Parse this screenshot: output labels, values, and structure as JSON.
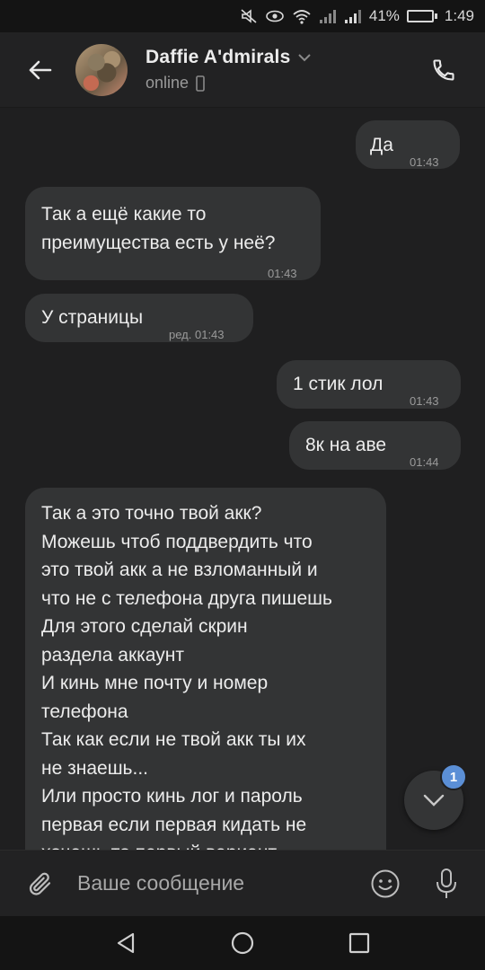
{
  "status_bar": {
    "battery_text": "41%",
    "time": "1:49",
    "battery_level": 0.41
  },
  "header": {
    "name": "Daffie A'dmirals",
    "status": "online"
  },
  "messages": [
    {
      "direction": "out",
      "text": "Да",
      "time": "01:43"
    },
    {
      "direction": "in",
      "text": "Так а ещё какие то\nпреимущества есть у неё?",
      "time": "01:43"
    },
    {
      "direction": "in",
      "text": "У страницы",
      "time": "ред. 01:43"
    },
    {
      "direction": "out",
      "text": "1 стик лол",
      "time": "01:43"
    },
    {
      "direction": "out",
      "text": "8к на аве",
      "time": "01:44"
    },
    {
      "direction": "in",
      "text": "Так а это точно твой акк?\nМожешь чтоб поддвердить что\nэто твой акк а не взломанный и\nчто не с телефона друга пишешь\nДля этого сделай скрин\nраздела аккаунт\nИ кинь мне почту и номер\nтелефона\nТак как если не твой акк ты их\nне знаешь...\nИли просто кинь лог и пароль\nпервая если первая кидать не\nхочешь то первый вариант",
      "time": ""
    }
  ],
  "scroll_down": {
    "unread_count": "1"
  },
  "composer": {
    "placeholder": "Ваше сообщение"
  },
  "icons": {
    "back": "arrow-left-icon",
    "call": "phone-icon",
    "attach": "paperclip-icon",
    "emoji": "smiley-icon",
    "mic": "microphone-icon",
    "scroll": "chevron-down-icon"
  },
  "colors": {
    "background": "#1f1f20",
    "bubble": "#333435",
    "badge": "#5b8fd6",
    "header": "#222223"
  }
}
